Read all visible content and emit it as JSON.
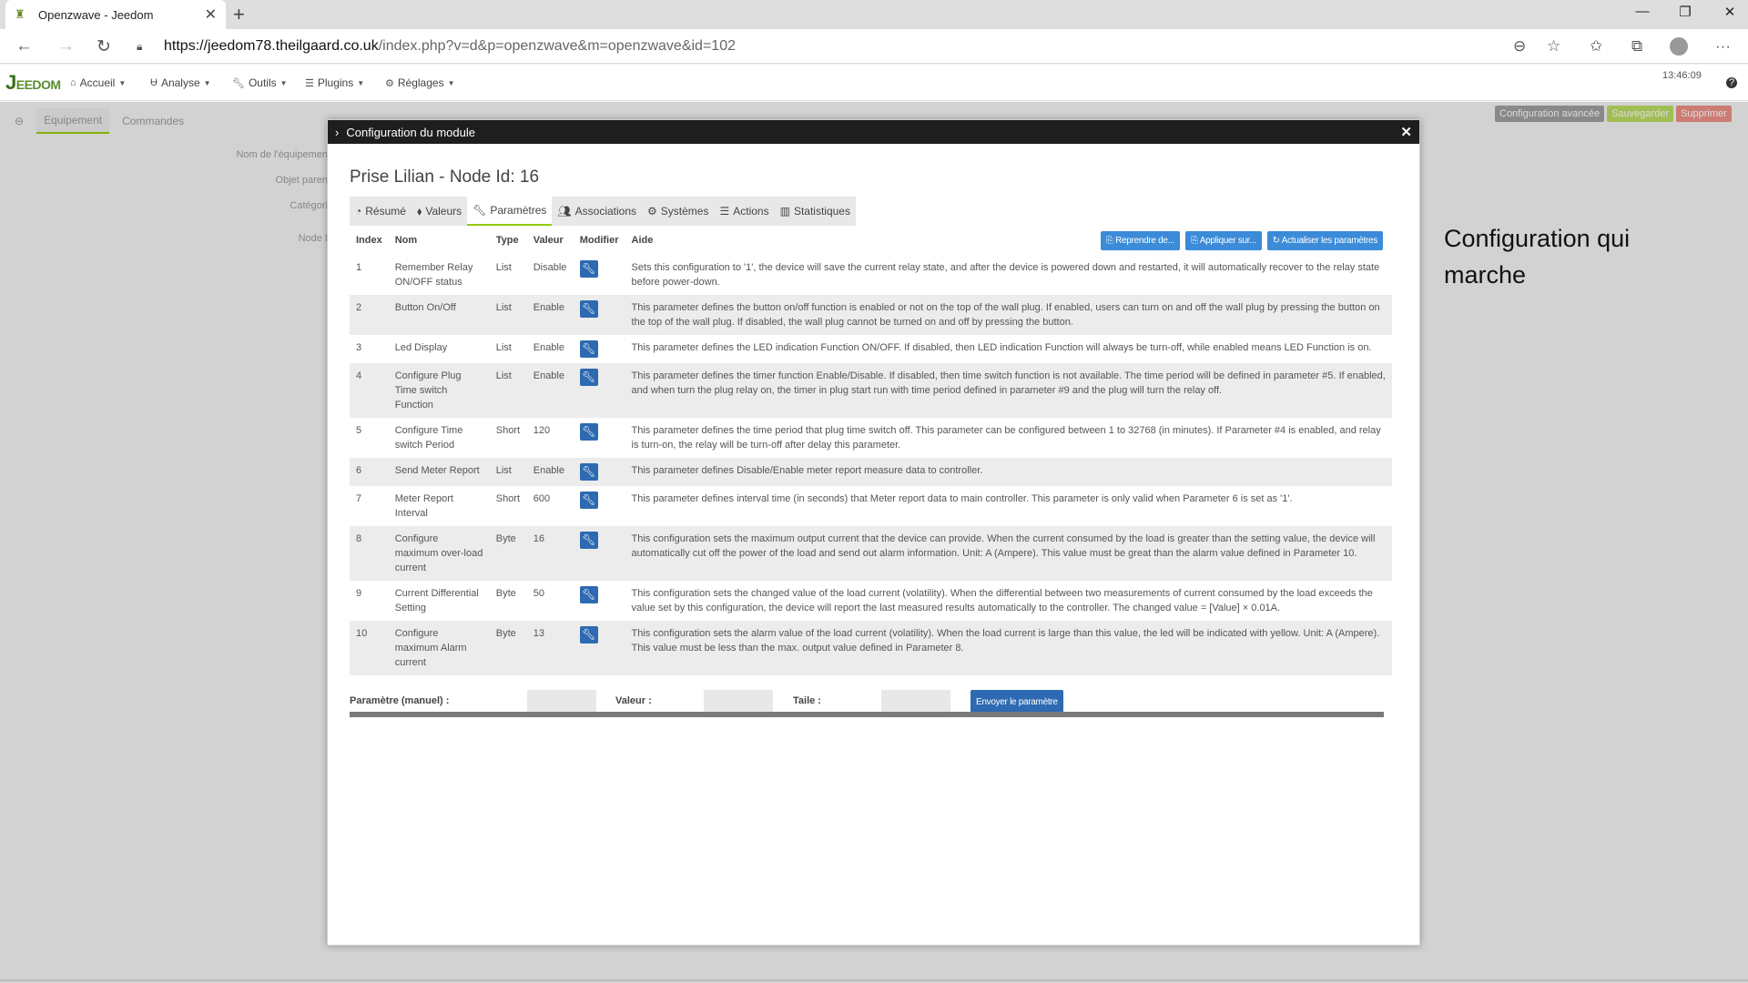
{
  "browser": {
    "tab_title": "Openzwave - Jeedom",
    "url_host": "https://jeedom78.theilgaard.co.uk",
    "url_rest": "/index.php?v=d&p=openzwave&m=openzwave&id=102"
  },
  "app": {
    "logo_text": "EEDOM",
    "logo_initial": "J",
    "menu": [
      {
        "label": "Accueil",
        "icon": "home-icon"
      },
      {
        "label": "Analyse",
        "icon": "magnet-icon"
      },
      {
        "label": "Outils",
        "icon": "wrench-icon"
      },
      {
        "label": "Plugins",
        "icon": "list-icon"
      },
      {
        "label": "Réglages",
        "icon": "cogs-icon"
      }
    ],
    "clock": "13:46:09"
  },
  "background": {
    "tabs": [
      "Equipement",
      "Commandes"
    ],
    "buttons": [
      {
        "label": "Configuration avancée",
        "color": "#666666"
      },
      {
        "label": "Sauvegarder",
        "color": "#94ca02"
      },
      {
        "label": "Supprimer",
        "color": "#e74c3c"
      }
    ],
    "labels": [
      "Nom de l'équipemen",
      "Objet paren",
      "Catégori",
      "Node I"
    ]
  },
  "modal": {
    "header": "Configuration du module",
    "title": "Prise Lilian - Node Id: 16",
    "tabs": [
      {
        "label": "Résumé",
        "icon": "tachometer-icon"
      },
      {
        "label": "Valeurs",
        "icon": "tag-icon"
      },
      {
        "label": "Paramètres",
        "icon": "wrench-icon"
      },
      {
        "label": "Associations",
        "icon": "users-icon"
      },
      {
        "label": "Systèmes",
        "icon": "cogs-icon"
      },
      {
        "label": "Actions",
        "icon": "bars-icon"
      },
      {
        "label": "Statistiques",
        "icon": "bar-chart-icon"
      }
    ],
    "active_tab": "Paramètres",
    "top_buttons": [
      "Reprendre de...",
      "Appliquer sur...",
      "Actualiser les paramètres"
    ],
    "columns": [
      "Index",
      "Nom",
      "Type",
      "Valeur",
      "Modifier",
      "Aide"
    ],
    "rows": [
      {
        "index": "1",
        "name": "Remember Relay ON/OFF status",
        "type": "List",
        "value": "Disable",
        "help": "Sets this configuration to '1', the device will save the current relay state, and after the device is powered down and restarted, it will automatically recover to the relay state before power-down."
      },
      {
        "index": "2",
        "name": "Button On/Off",
        "type": "List",
        "value": "Enable",
        "help": "This parameter defines the button on/off function is enabled or not on the top of the wall plug. If enabled, users can turn on and off the wall plug by pressing the button on the top of the wall plug. If disabled, the wall plug cannot be turned on and off by pressing the button."
      },
      {
        "index": "3",
        "name": "Led Display",
        "type": "List",
        "value": "Enable",
        "help": "This parameter defines the LED indication Function ON/OFF. If disabled, then LED indication Function will always be turn-off, while enabled means LED Function is on."
      },
      {
        "index": "4",
        "name": "Configure Plug Time switch Function",
        "type": "List",
        "value": "Enable",
        "help": "This parameter defines the timer function Enable/Disable. If disabled, then time switch function is not available. The time period will be defined in parameter #5. If enabled, and when turn the plug relay on, the timer in plug start run with time period defined in parameter #9 and the plug will turn the relay off."
      },
      {
        "index": "5",
        "name": "Configure Time switch Period",
        "type": "Short",
        "value": "120",
        "help": "This parameter defines the time period that plug time switch off. This parameter can be configured between 1 to 32768 (in minutes). If Parameter #4 is enabled, and relay is turn-on, the relay will be turn-off after delay this parameter."
      },
      {
        "index": "6",
        "name": "Send Meter Report",
        "type": "List",
        "value": "Enable",
        "help": "This parameter defines Disable/Enable meter report measure data to controller."
      },
      {
        "index": "7",
        "name": "Meter Report Interval",
        "type": "Short",
        "value": "600",
        "help": "This parameter defines interval time (in seconds) that Meter report data to main controller. This parameter is only valid when Parameter 6 is set as '1'."
      },
      {
        "index": "8",
        "name": "Configure maximum over-load current",
        "type": "Byte",
        "value": "16",
        "help": "This configuration sets the maximum output current that the device can provide. When the current consumed by the load is greater than the setting value, the device will automatically cut off the power of the load and send out alarm information. Unit: A (Ampere). This value must be great than the alarm value defined in Parameter 10."
      },
      {
        "index": "9",
        "name": "Current Differential Setting",
        "type": "Byte",
        "value": "50",
        "help": "This configuration sets the changed value of the load current (volatility). When the differential between two measurements of current consumed by the load exceeds the value set by this configuration, the device will report the last measured results automatically to the controller. The changed value = [Value] × 0.01A."
      },
      {
        "index": "10",
        "name": "Configure maximum Alarm current",
        "type": "Byte",
        "value": "13",
        "help": "This configuration sets the alarm value of the load current (volatility). When the load current is large than this value, the led will be indicated with yellow. Unit: A (Ampere). This value must be less than the max. output value defined in Parameter 8."
      }
    ],
    "manual": {
      "param_label": "Paramètre (manuel) :",
      "value_label": "Valeur :",
      "size_label": "Taile :",
      "send_button": "Envoyer le paramètre"
    }
  },
  "annotation": "Configuration qui marche",
  "colors": {
    "accent": "#94ca02",
    "button_blue": "#2d6ab2"
  }
}
